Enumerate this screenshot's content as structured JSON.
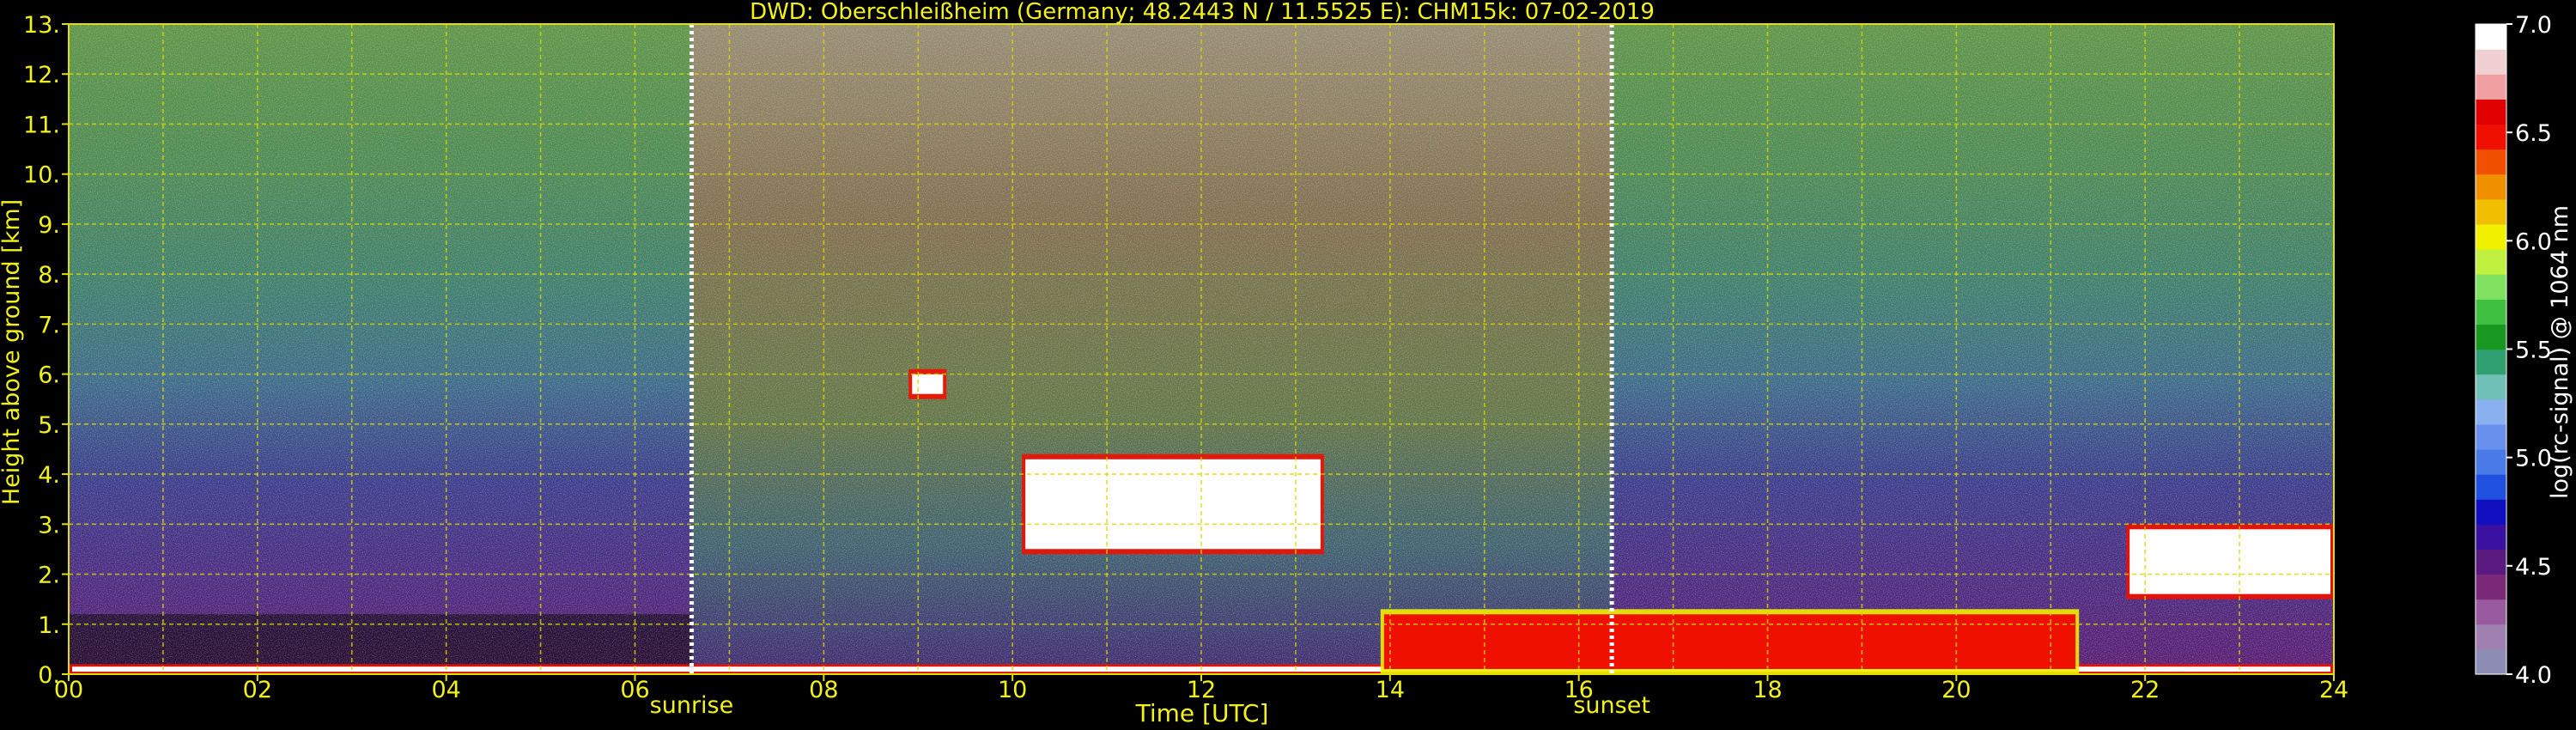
{
  "chart_data": {
    "type": "heatmap",
    "title": "DWD: Oberschleißheim (Germany; 48.2443 N / 11.5525 E):    CHM15k: 07-02-2019",
    "xlabel": "Time [UTC]",
    "ylabel": "Height above ground [km]",
    "xlim": [
      0,
      24
    ],
    "ylim": [
      0,
      13
    ],
    "x_tick_labels": [
      "00",
      "02",
      "04",
      "06",
      "08",
      "10",
      "12",
      "14",
      "16",
      "18",
      "20",
      "22",
      "24"
    ],
    "x_tick_values": [
      0,
      2,
      4,
      6,
      8,
      10,
      12,
      14,
      16,
      18,
      20,
      22,
      24
    ],
    "y_tick_labels": [
      "0.",
      "1.",
      "2.",
      "3.",
      "4.",
      "5.",
      "6.",
      "7.",
      "8.",
      "9.",
      "10.",
      "11.",
      "12.",
      "13."
    ],
    "y_tick_values": [
      0,
      1,
      2,
      3,
      4,
      5,
      6,
      7,
      8,
      9,
      10,
      11,
      12,
      13
    ],
    "grid": true,
    "markers": [
      {
        "label": "sunrise",
        "time": 6.6
      },
      {
        "label": "sunset",
        "time": 16.35
      }
    ],
    "colorbar": {
      "label": "log(rc-signal) @ 1064 nm",
      "range": [
        4.0,
        7.0
      ],
      "tick_labels": [
        "4.0",
        "4.5",
        "5.0",
        "5.5",
        "6.0",
        "6.5",
        "7.0"
      ],
      "tick_values": [
        4.0,
        4.5,
        5.0,
        5.5,
        6.0,
        6.5,
        7.0
      ],
      "colors": [
        "#8c8cb4",
        "#a080b0",
        "#9a5aa0",
        "#7a2a78",
        "#5a1a80",
        "#3a10a0",
        "#1010c0",
        "#2050e0",
        "#4a7ae8",
        "#6a90ee",
        "#8ab0f0",
        "#70c0b8",
        "#30a070",
        "#189820",
        "#40c040",
        "#80e060",
        "#c0f040",
        "#f0f000",
        "#f0c000",
        "#f09000",
        "#f05000",
        "#f01000",
        "#e00000",
        "#f0a0a0",
        "#f0d0d0",
        "#ffffff"
      ]
    },
    "features": [
      {
        "name": "surface layer",
        "x": [
          0,
          24
        ],
        "top_km": 0.2,
        "level": 7.0
      },
      {
        "name": "cloud layer 1",
        "x": [
          8.9,
          9.3
        ],
        "top_km": 6.1,
        "base_km": 5.5,
        "level": 7.0
      },
      {
        "name": "cloud layer 2",
        "x": [
          10.1,
          13.3
        ],
        "top_km": 4.4,
        "base_km": 2.4,
        "level": 7.0
      },
      {
        "name": "low cloud band",
        "x": [
          13.9,
          21.3
        ],
        "top_km": 1.3,
        "base_km": 0.0,
        "level": 6.5
      },
      {
        "name": "night cloud",
        "x": [
          21.8,
          24
        ],
        "top_km": 3.0,
        "base_km": 1.5,
        "level": 7.0
      }
    ]
  }
}
